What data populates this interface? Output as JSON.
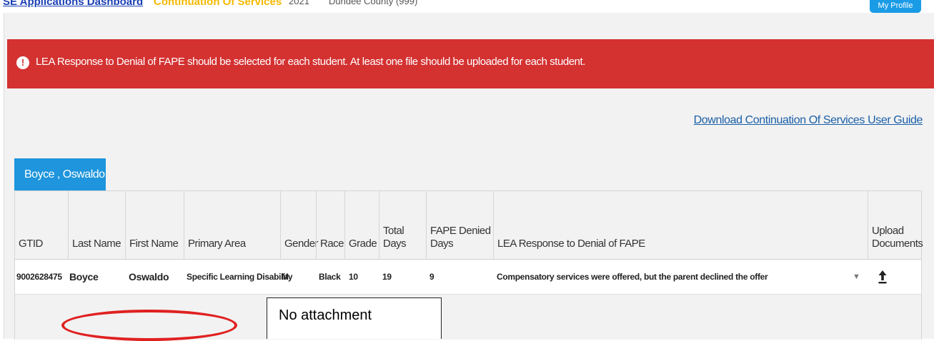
{
  "topbar": {
    "crumb_dashboard": "SE Applications Dashboard",
    "crumb_module": "Continuation Of Services",
    "crumb_year": "2021",
    "crumb_district": "Dundee County (999)",
    "button_label": "My Profile"
  },
  "alert": {
    "icon": "exclamation-icon",
    "message": "LEA Response to Denial of FAPE should be selected for each student. At least one file should be uploaded for each student."
  },
  "guide_link": "Download Continuation Of Services User Guide",
  "student_tab": "Boyce , Oswaldo",
  "table": {
    "headers": {
      "gtid": "GTID",
      "last_name": "Last Name",
      "first_name": "First Name",
      "primary_area": "Primary Area",
      "gender": "Gender",
      "race": "Race",
      "grade": "Grade",
      "total_days": "Total Days",
      "fape_denied_days_l1": "FAPE Denied",
      "fape_denied_days_l2": "Days",
      "lea_response": "LEA Response to Denial of FAPE",
      "upload_l1": "Upload",
      "upload_l2": "Documents"
    },
    "row": {
      "gtid": "9002628475",
      "last_name": "Boyce",
      "first_name": "Oswaldo",
      "primary_area": "Specific Learning Disability",
      "gender": "M",
      "race": "Black",
      "grade": "10",
      "total_days": "19",
      "fape_denied_days": "9",
      "lea_response": "Compensatory services were offered, but the parent declined the offer"
    }
  },
  "annotation": {
    "callout_text": "No attachment",
    "ellipse_color": "#e02020"
  },
  "colors": {
    "alert_bg": "#d43131",
    "tab_bg": "#1e95dd",
    "link": "#1a5fa8"
  }
}
